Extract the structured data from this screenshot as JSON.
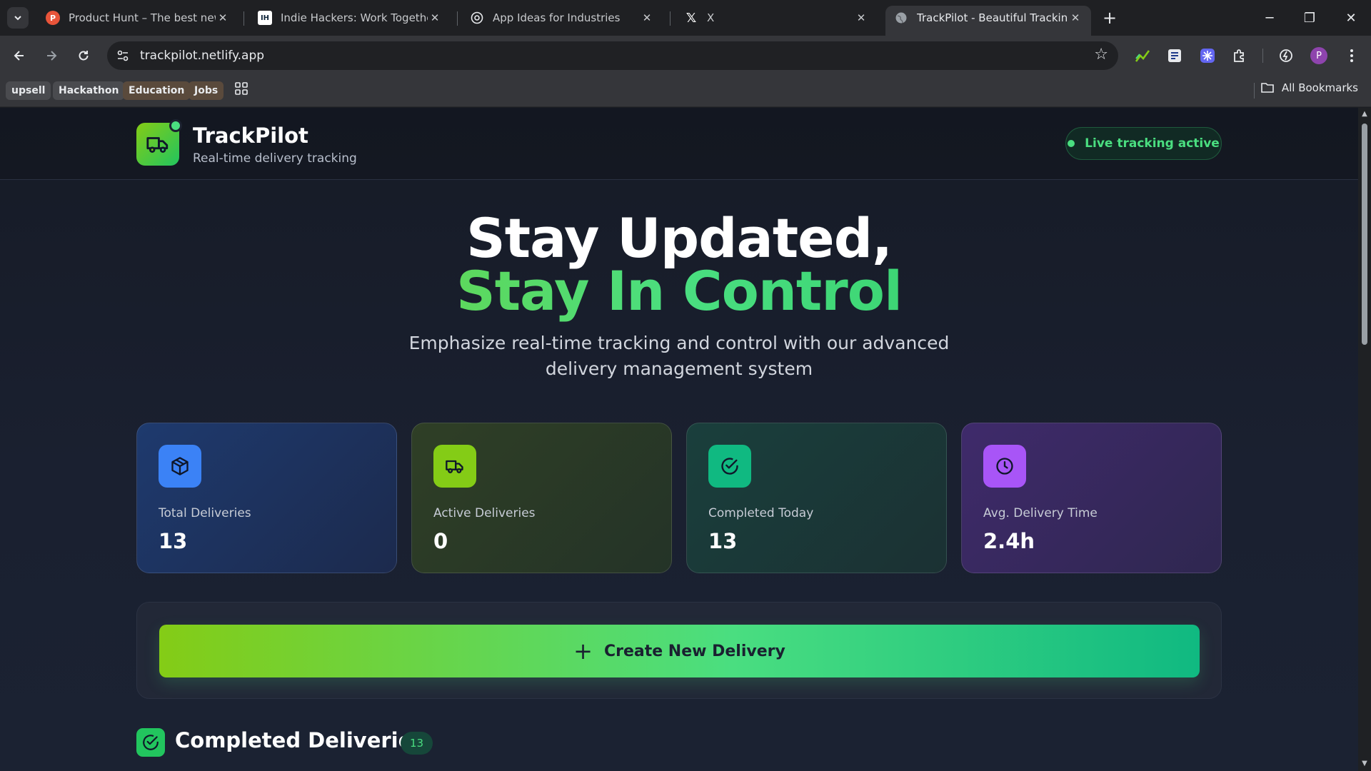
{
  "browser": {
    "tabs": [
      {
        "title": "Product Hunt – The best new p",
        "favicon": "P",
        "active": false
      },
      {
        "title": "Indie Hackers: Work Together t",
        "favicon": "IH",
        "active": false
      },
      {
        "title": "App Ideas for Industries",
        "favicon": "openai-icon",
        "active": false
      },
      {
        "title": "X",
        "favicon": "X",
        "active": false
      },
      {
        "title": "TrackPilot - Beautiful Tracking D",
        "favicon": "globe-icon",
        "active": true
      }
    ],
    "url": "trackpilot.netlify.app",
    "profile_initial": "P",
    "bookmarks": [
      "upsell",
      "Hackathon",
      "Education",
      "Jobs"
    ],
    "all_bookmarks_label": "All Bookmarks"
  },
  "header": {
    "brand": "TrackPilot",
    "tagline": "Real-time delivery tracking",
    "live_status": "Live tracking active"
  },
  "hero": {
    "line1": "Stay Updated,",
    "line2": "Stay In Control",
    "subtitle": "Emphasize real-time tracking and control with our advanced delivery management system"
  },
  "stats": [
    {
      "label": "Total Deliveries",
      "value": "13",
      "icon": "box-icon",
      "accent": "#3b82f6"
    },
    {
      "label": "Active Deliveries",
      "value": "0",
      "icon": "truck-icon",
      "accent": "#84cc16"
    },
    {
      "label": "Completed Today",
      "value": "13",
      "icon": "check-circle-icon",
      "accent": "#10b981"
    },
    {
      "label": "Avg. Delivery Time",
      "value": "2.4h",
      "icon": "clock-icon",
      "accent": "#a855f7"
    }
  ],
  "actions": {
    "create_label": "Create New Delivery"
  },
  "completed_section": {
    "title": "Completed Deliveries",
    "count": "13"
  },
  "colors": {
    "accent_green": "#4ade80",
    "accent_lime": "#84cc16",
    "background": "#1a2030"
  }
}
